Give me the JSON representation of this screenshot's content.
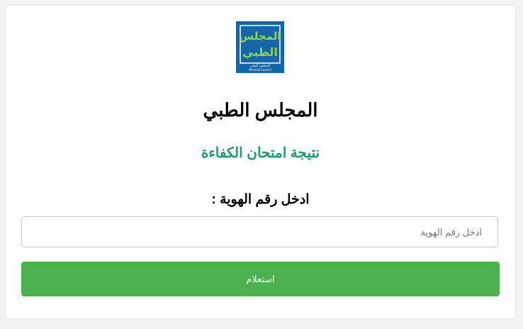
{
  "logo": {
    "icon": "medical-council-logo",
    "line1": "المجلس",
    "line2": "الطبي",
    "caption_ar": "المجلس الطبي",
    "caption_en": "Medical Council",
    "colors": {
      "background": "#1665a6",
      "letters": "#8fd35a",
      "border": "#ffffff"
    }
  },
  "header": {
    "title": "المجلس الطبي",
    "subtitle": "نتيجة امتحان الكفاءة"
  },
  "form": {
    "label": "ادخل رقم الهوية :",
    "input_placeholder": "ادخل رقم الهوية",
    "input_value": "",
    "submit_label": "استعلام"
  },
  "colors": {
    "page_bg": "#f2f2f2",
    "card_bg": "#ffffff",
    "subtitle": "#1e9c6c",
    "button": "#4caf50"
  }
}
